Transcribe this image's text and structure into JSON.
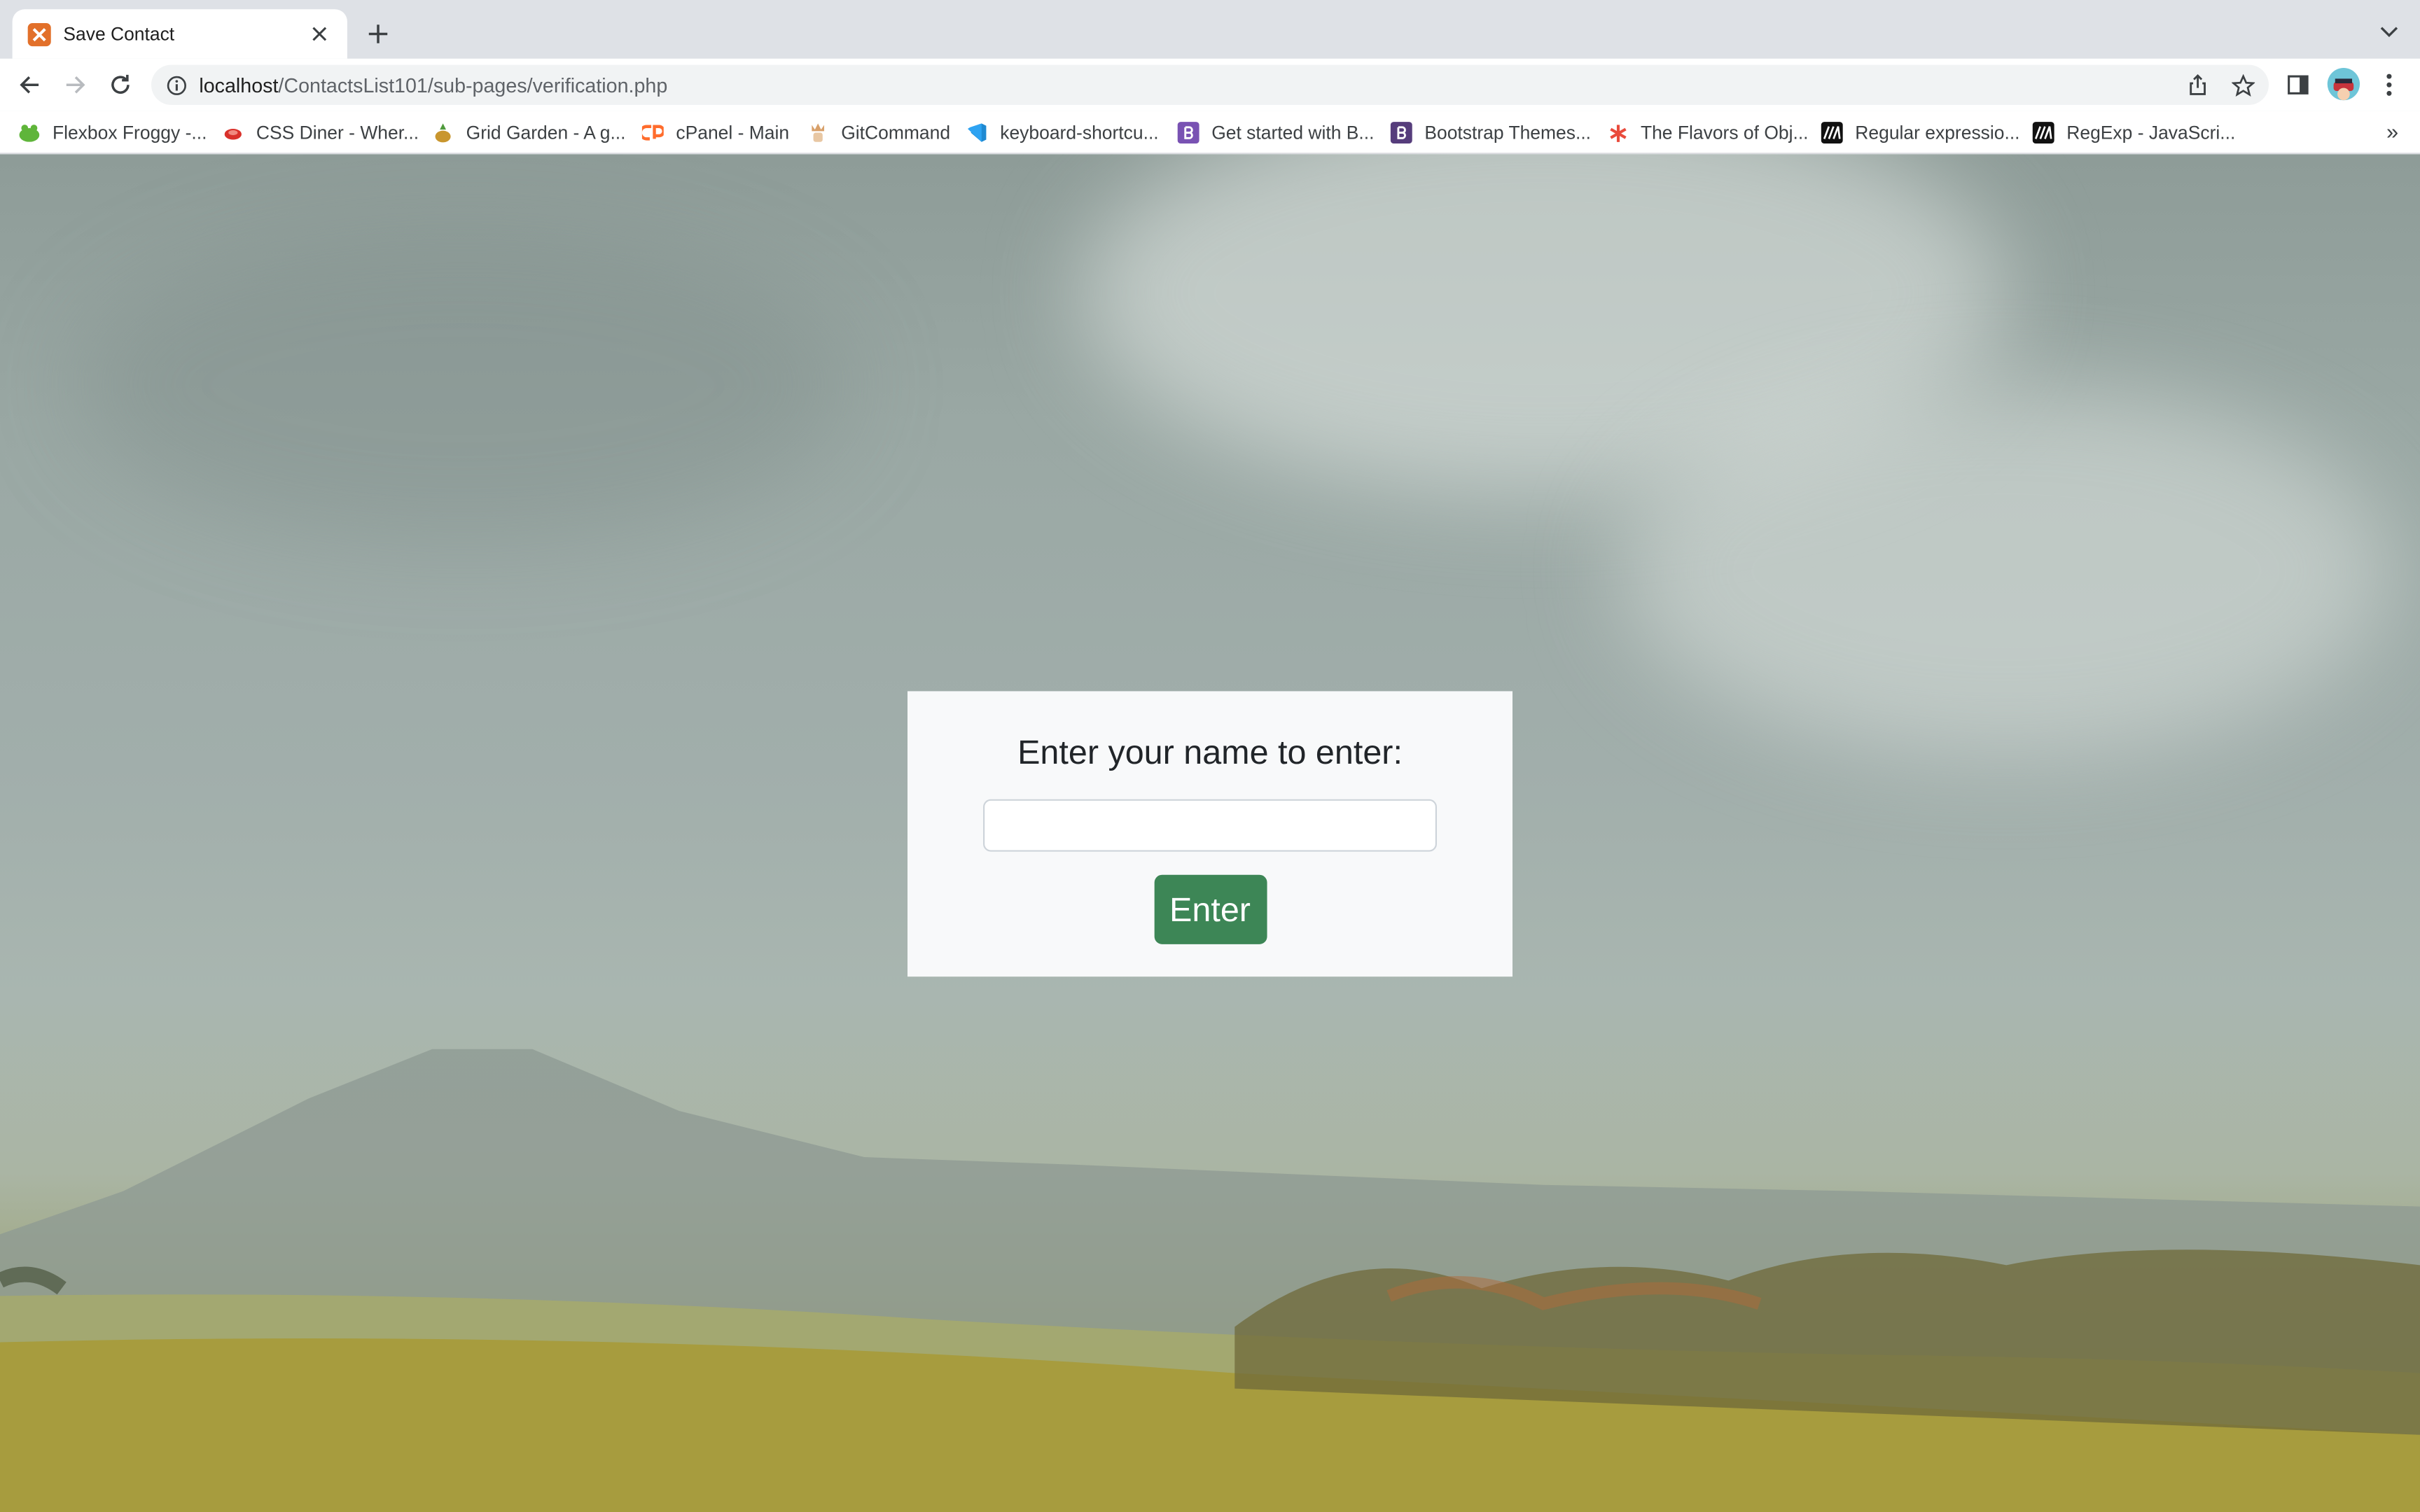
{
  "browser": {
    "tab": {
      "title": "Save Contact"
    },
    "address": {
      "host": "localhost",
      "path": "/ContactsList101/sub-pages/verification.php"
    },
    "bookmarks": [
      {
        "label": "Flexbox Froggy -...",
        "icon": "frog-icon",
        "color": "#5fb53a"
      },
      {
        "label": "CSS Diner - Wher...",
        "icon": "plate-icon",
        "color": "#d9312b"
      },
      {
        "label": "Grid Garden - A g...",
        "icon": "carrot-icon",
        "color": "#b98e2a"
      },
      {
        "label": "cPanel - Main",
        "icon": "cpanel-icon",
        "color": "#ff6c2c"
      },
      {
        "label": "GitCommand",
        "icon": "git-icon",
        "color": "#d8a06a"
      },
      {
        "label": "keyboard-shortcu...",
        "icon": "vscode-icon",
        "color": "#1f8ad2"
      },
      {
        "label": "Get started with B...",
        "icon": "bootstrap-icon",
        "color": "#7952b3"
      },
      {
        "label": "Bootstrap Themes...",
        "icon": "bootstrap-icon",
        "color": "#563d7c"
      },
      {
        "label": "The Flavors of Obj...",
        "icon": "asterisk-icon",
        "color": "#e94b3c"
      },
      {
        "label": "Regular expressio...",
        "icon": "mdn-icon",
        "color": "#111111"
      },
      {
        "label": "RegExp - JavaScri...",
        "icon": "mdn-icon",
        "color": "#111111"
      }
    ],
    "more_bookmarks": "»"
  },
  "form": {
    "title": "Enter your name to enter:",
    "input_value": "",
    "input_placeholder": "",
    "button_label": "Enter",
    "button_color": "#3d8656"
  }
}
